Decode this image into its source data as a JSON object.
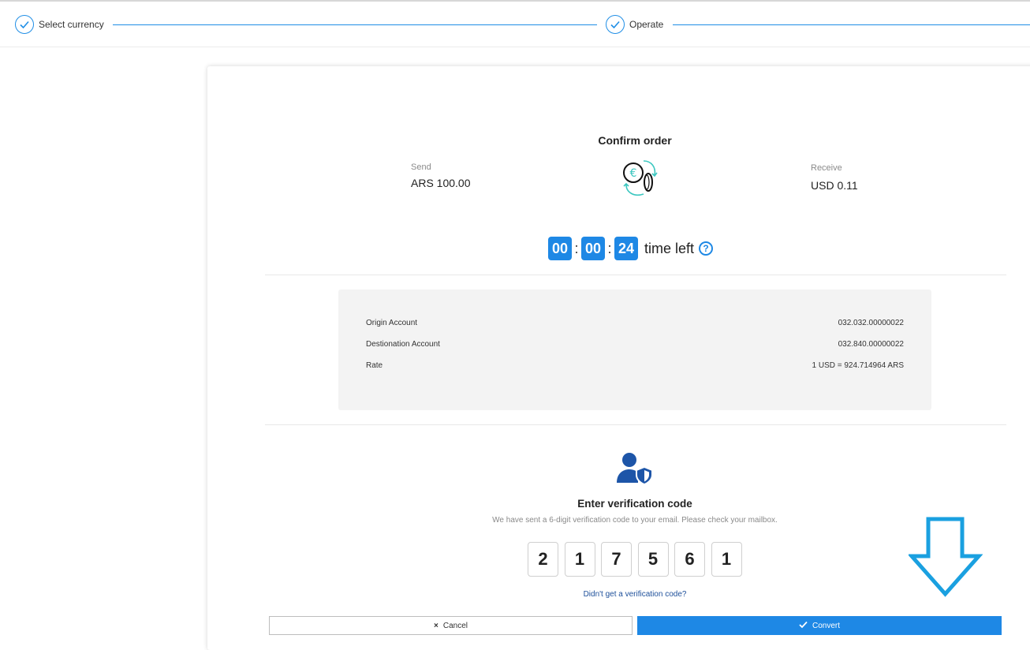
{
  "stepper": {
    "steps": [
      {
        "label": "Select currency"
      },
      {
        "label": "Operate"
      }
    ]
  },
  "order": {
    "title": "Confirm order",
    "send_label": "Send",
    "send_amount": "ARS 100.00",
    "receive_label": "Receive",
    "receive_amount": "USD 0.11",
    "icon": "currency-exchange-icon"
  },
  "timer": {
    "hours": "00",
    "minutes": "00",
    "seconds": "24",
    "label": "time left",
    "separator": ":"
  },
  "details": [
    {
      "key": "Origin Account",
      "value": "032.032.00000022"
    },
    {
      "key": "Destionation Account",
      "value": "032.840.00000022"
    },
    {
      "key": "Rate",
      "value": "1 USD = 924.714964 ARS"
    }
  ],
  "verification": {
    "icon": "user-shield-icon",
    "title": "Enter verification code",
    "subtitle": "We have sent a 6-digit verification code to your email. Please check your mailbox.",
    "digits": [
      "2",
      "1",
      "7",
      "5",
      "6",
      "1"
    ],
    "resend_link": "Didn't get a verification code?"
  },
  "actions": {
    "cancel_label": "Cancel",
    "convert_label": "Convert"
  },
  "colors": {
    "accent": "#1e88e5",
    "arrow": "#1aa0e0"
  }
}
